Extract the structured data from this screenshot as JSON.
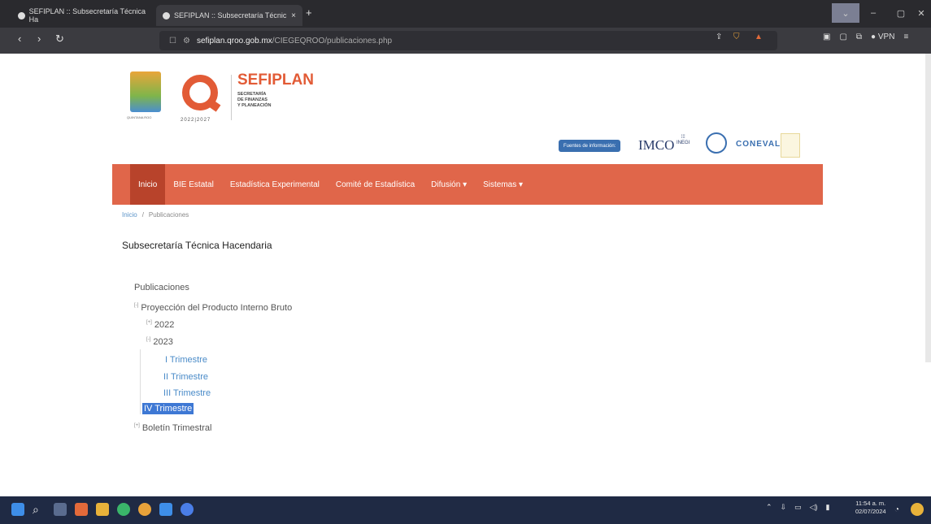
{
  "browser": {
    "tabs": [
      {
        "title": "SEFIPLAN :: Subsecretaría Técnica Ha",
        "active": false
      },
      {
        "title": "SEFIPLAN :: Subsecretaría Técnic",
        "active": true
      }
    ],
    "new_tab_symbol": "+",
    "close_symbol": "×",
    "url_host": "sefiplan.qroo.gob.mx",
    "url_path": "/CIEGEQROO/publicaciones.php",
    "vpn_label": "VPN"
  },
  "header": {
    "state_caption": "QUINTANA ROO",
    "logo_years": "2022|2027",
    "brand": "SEFIPLAN",
    "brand_sub1": "SECRETARÍA",
    "brand_sub2": "DE FINANZAS",
    "brand_sub3": "Y PLANEACIÓN"
  },
  "sources": {
    "label": "Fuentes de información:",
    "imco": "IMCO",
    "inegi": "INEGI",
    "coneval": "CONEVAL"
  },
  "menu": {
    "items": [
      {
        "label": "Inicio",
        "active": true
      },
      {
        "label": "BIE Estatal"
      },
      {
        "label": "Estadística Experimental"
      },
      {
        "label": "Comité de Estadística"
      },
      {
        "label": "Difusión ▾"
      },
      {
        "label": "Sistemas ▾"
      }
    ]
  },
  "breadcrumb": {
    "home": "Inicio",
    "current": "Publicaciones"
  },
  "page_title": "Subsecretaría Técnica Hacendaria",
  "tree": {
    "root": "Publicaciones",
    "node1": "Proyección del Producto Interno Bruto",
    "year2022": "2022",
    "year2023": "2023",
    "leaves": [
      "I Trimestre",
      "II Trimestre",
      "III Trimestre",
      "IV Trimestre"
    ],
    "node2": "Boletín Trimestral",
    "expanded_marker": "[-]",
    "collapsed_marker": "[+]"
  },
  "taskbar": {
    "time": "11:54 a. m.",
    "date": "02/07/2024"
  },
  "colors": {
    "menu_bar": "#e0664a",
    "menu_active": "#b8432b",
    "brand": "#e25b36",
    "link": "#4a8bc8",
    "selection": "#3e78d4"
  }
}
